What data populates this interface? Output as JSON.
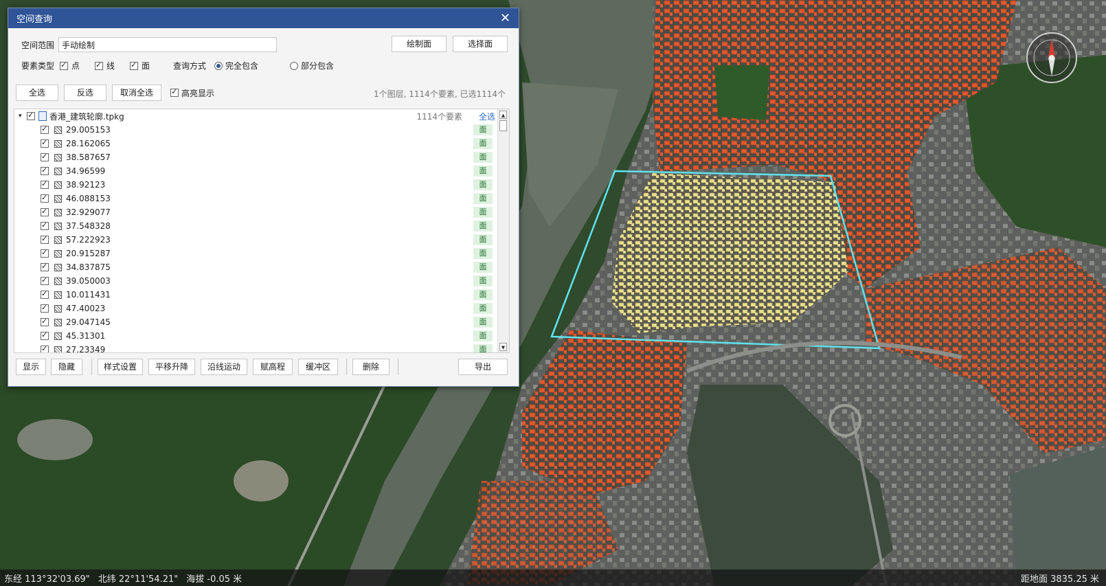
{
  "dialog": {
    "title": "空间查询",
    "close_glyph": "✕",
    "range_label": "空间范围",
    "range_value": "手动绘制",
    "draw_button": "绘制面",
    "select_button": "选择面",
    "feature_type_label": "要素类型",
    "feature_types": [
      {
        "label": "点",
        "checked": true
      },
      {
        "label": "线",
        "checked": true
      },
      {
        "label": "面",
        "checked": true
      }
    ],
    "query_mode_label": "查询方式",
    "query_modes": [
      {
        "label": "完全包含",
        "selected": true
      },
      {
        "label": "部分包含",
        "selected": false
      }
    ],
    "select_all_button": "全选",
    "invert_button": "反选",
    "deselect_button": "取消全选",
    "highlight_label": "高亮显示",
    "highlight_checked": true,
    "summary": "1个图层, 1114个要素, 已选1114个",
    "layer": {
      "name": "香港_建筑轮廓.tpkg",
      "count": "1114个要素",
      "select_all": "全选"
    },
    "features": [
      {
        "value": "29.005153",
        "type": "面"
      },
      {
        "value": "28.162065",
        "type": "面"
      },
      {
        "value": "38.587657",
        "type": "面"
      },
      {
        "value": "34.96599",
        "type": "面"
      },
      {
        "value": "38.92123",
        "type": "面"
      },
      {
        "value": "46.088153",
        "type": "面"
      },
      {
        "value": "32.929077",
        "type": "面"
      },
      {
        "value": "37.548328",
        "type": "面"
      },
      {
        "value": "57.222923",
        "type": "面"
      },
      {
        "value": "20.915287",
        "type": "面"
      },
      {
        "value": "34.837875",
        "type": "面"
      },
      {
        "value": "39.050003",
        "type": "面"
      },
      {
        "value": "10.011431",
        "type": "面"
      },
      {
        "value": "47.40023",
        "type": "面"
      },
      {
        "value": "29.047145",
        "type": "面"
      },
      {
        "value": "45.31301",
        "type": "面"
      },
      {
        "value": "27.23349",
        "type": "面"
      }
    ],
    "bottom_buttons": {
      "show": "显示",
      "hide": "隐藏",
      "style": "样式设置",
      "translate": "平移升降",
      "path_motion": "沿线运动",
      "assign_elevation": "赋高程",
      "buffer": "缓冲区",
      "delete": "删除",
      "export": "导出"
    }
  },
  "status": {
    "longitude": "东经 113°32'03.69\"",
    "latitude": "北纬 22°11'54.21\"",
    "altitude": "海拔 -0.05 米",
    "distance": "距地面 3835.25 米"
  },
  "colors": {
    "title_bar": "#2f5597",
    "selection_outline": "#5fe4f0",
    "highlight_fill": "#e9dc8e",
    "building_fill": "#e8582a",
    "tag_bg": "#dff2e0"
  }
}
